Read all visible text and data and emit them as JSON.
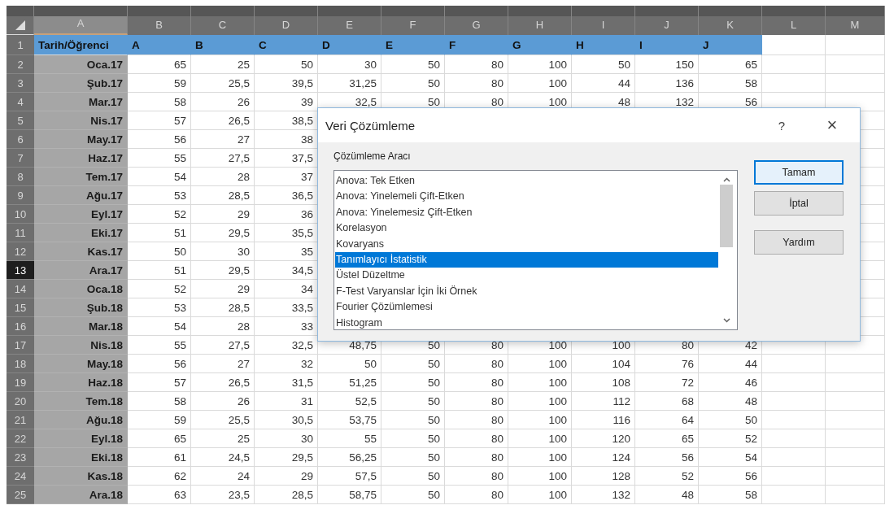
{
  "sheet": {
    "columns": [
      {
        "label": "A",
        "selected": true
      },
      {
        "label": "B",
        "selected": false
      },
      {
        "label": "C",
        "selected": false
      },
      {
        "label": "D",
        "selected": false
      },
      {
        "label": "E",
        "selected": false
      },
      {
        "label": "F",
        "selected": false
      },
      {
        "label": "G",
        "selected": false
      },
      {
        "label": "H",
        "selected": false
      },
      {
        "label": "I",
        "selected": false
      },
      {
        "label": "J",
        "selected": false
      },
      {
        "label": "K",
        "selected": false
      },
      {
        "label": "L",
        "selected": false
      },
      {
        "label": "M",
        "selected": false
      }
    ],
    "rows": [
      {
        "number": "1",
        "selected": false,
        "kind": "header",
        "cells": [
          "Tarih/Öğrenci",
          "A",
          "B",
          "C",
          "D",
          "E",
          "F",
          "G",
          "H",
          "I",
          "J"
        ]
      },
      {
        "number": "2",
        "selected": false,
        "kind": "data",
        "cells": [
          "Oca.17",
          "65",
          "25",
          "50",
          "30",
          "50",
          "80",
          "100",
          "50",
          "150",
          "65"
        ]
      },
      {
        "number": "3",
        "selected": false,
        "kind": "data",
        "cells": [
          "Şub.17",
          "59",
          "25,5",
          "39,5",
          "31,25",
          "50",
          "80",
          "100",
          "44",
          "136",
          "58"
        ]
      },
      {
        "number": "4",
        "selected": false,
        "kind": "data",
        "cells": [
          "Mar.17",
          "58",
          "26",
          "39",
          "32,5",
          "50",
          "80",
          "100",
          "48",
          "132",
          "56"
        ]
      },
      {
        "number": "5",
        "selected": false,
        "kind": "data",
        "cells": [
          "Nis.17",
          "57",
          "26,5",
          "38,5"
        ]
      },
      {
        "number": "6",
        "selected": false,
        "kind": "data",
        "cells": [
          "May.17",
          "56",
          "27",
          "38"
        ]
      },
      {
        "number": "7",
        "selected": false,
        "kind": "data",
        "cells": [
          "Haz.17",
          "55",
          "27,5",
          "37,5"
        ]
      },
      {
        "number": "8",
        "selected": false,
        "kind": "data",
        "cells": [
          "Tem.17",
          "54",
          "28",
          "37"
        ]
      },
      {
        "number": "9",
        "selected": false,
        "kind": "data",
        "cells": [
          "Ağu.17",
          "53",
          "28,5",
          "36,5"
        ]
      },
      {
        "number": "10",
        "selected": false,
        "kind": "data",
        "cells": [
          "Eyl.17",
          "52",
          "29",
          "36"
        ]
      },
      {
        "number": "11",
        "selected": false,
        "kind": "data",
        "cells": [
          "Eki.17",
          "51",
          "29,5",
          "35,5"
        ]
      },
      {
        "number": "12",
        "selected": false,
        "kind": "data",
        "cells": [
          "Kas.17",
          "50",
          "30",
          "35"
        ]
      },
      {
        "number": "13",
        "selected": true,
        "kind": "data",
        "cells": [
          "Ara.17",
          "51",
          "29,5",
          "34,5"
        ]
      },
      {
        "number": "14",
        "selected": false,
        "kind": "data",
        "cells": [
          "Oca.18",
          "52",
          "29",
          "34"
        ]
      },
      {
        "number": "15",
        "selected": false,
        "kind": "data",
        "cells": [
          "Şub.18",
          "53",
          "28,5",
          "33,5"
        ]
      },
      {
        "number": "16",
        "selected": false,
        "kind": "data",
        "cells": [
          "Mar.18",
          "54",
          "28",
          "33"
        ]
      },
      {
        "number": "17",
        "selected": false,
        "kind": "data",
        "cells": [
          "Nis.18",
          "55",
          "27,5",
          "32,5",
          "48,75",
          "50",
          "80",
          "100",
          "100",
          "80",
          "42"
        ]
      },
      {
        "number": "18",
        "selected": false,
        "kind": "data",
        "cells": [
          "May.18",
          "56",
          "27",
          "32",
          "50",
          "50",
          "80",
          "100",
          "104",
          "76",
          "44"
        ]
      },
      {
        "number": "19",
        "selected": false,
        "kind": "data",
        "cells": [
          "Haz.18",
          "57",
          "26,5",
          "31,5",
          "51,25",
          "50",
          "80",
          "100",
          "108",
          "72",
          "46"
        ]
      },
      {
        "number": "20",
        "selected": false,
        "kind": "data",
        "cells": [
          "Tem.18",
          "58",
          "26",
          "31",
          "52,5",
          "50",
          "80",
          "100",
          "112",
          "68",
          "48"
        ]
      },
      {
        "number": "21",
        "selected": false,
        "kind": "data",
        "cells": [
          "Ağu.18",
          "59",
          "25,5",
          "30,5",
          "53,75",
          "50",
          "80",
          "100",
          "116",
          "64",
          "50"
        ]
      },
      {
        "number": "22",
        "selected": false,
        "kind": "data",
        "cells": [
          "Eyl.18",
          "65",
          "25",
          "30",
          "55",
          "50",
          "80",
          "100",
          "120",
          "65",
          "52"
        ]
      },
      {
        "number": "23",
        "selected": false,
        "kind": "data",
        "cells": [
          "Eki.18",
          "61",
          "24,5",
          "29,5",
          "56,25",
          "50",
          "80",
          "100",
          "124",
          "56",
          "54"
        ]
      },
      {
        "number": "24",
        "selected": false,
        "kind": "data",
        "cells": [
          "Kas.18",
          "62",
          "24",
          "29",
          "57,5",
          "50",
          "80",
          "100",
          "128",
          "52",
          "56"
        ]
      },
      {
        "number": "25",
        "selected": false,
        "kind": "data",
        "cells": [
          "Ara.18",
          "63",
          "23,5",
          "28,5",
          "58,75",
          "50",
          "80",
          "100",
          "132",
          "48",
          "58"
        ]
      }
    ]
  },
  "dialog": {
    "title": "Veri Çözümleme",
    "help": "?",
    "close": "×",
    "label": "Çözümleme Aracı",
    "items": [
      {
        "label": "Anova: Tek Etken",
        "selected": false
      },
      {
        "label": "Anova: Yinelemeli Çift-Etken",
        "selected": false
      },
      {
        "label": "Anova: Yinelemesiz Çift-Etken",
        "selected": false
      },
      {
        "label": "Korelasyon",
        "selected": false
      },
      {
        "label": "Kovaryans",
        "selected": false
      },
      {
        "label": "Tanımlayıcı İstatistik",
        "selected": true
      },
      {
        "label": "Üstel Düzeltme",
        "selected": false
      },
      {
        "label": "F-Test Varyanslar İçin İki Örnek",
        "selected": false
      },
      {
        "label": "Fourier Çözümlemesi",
        "selected": false
      },
      {
        "label": "Histogram",
        "selected": false
      }
    ],
    "buttons": [
      {
        "label": "Tamam",
        "focused": true
      },
      {
        "label": "İptal",
        "focused": false
      },
      {
        "label": "Yardım",
        "focused": false
      }
    ]
  }
}
